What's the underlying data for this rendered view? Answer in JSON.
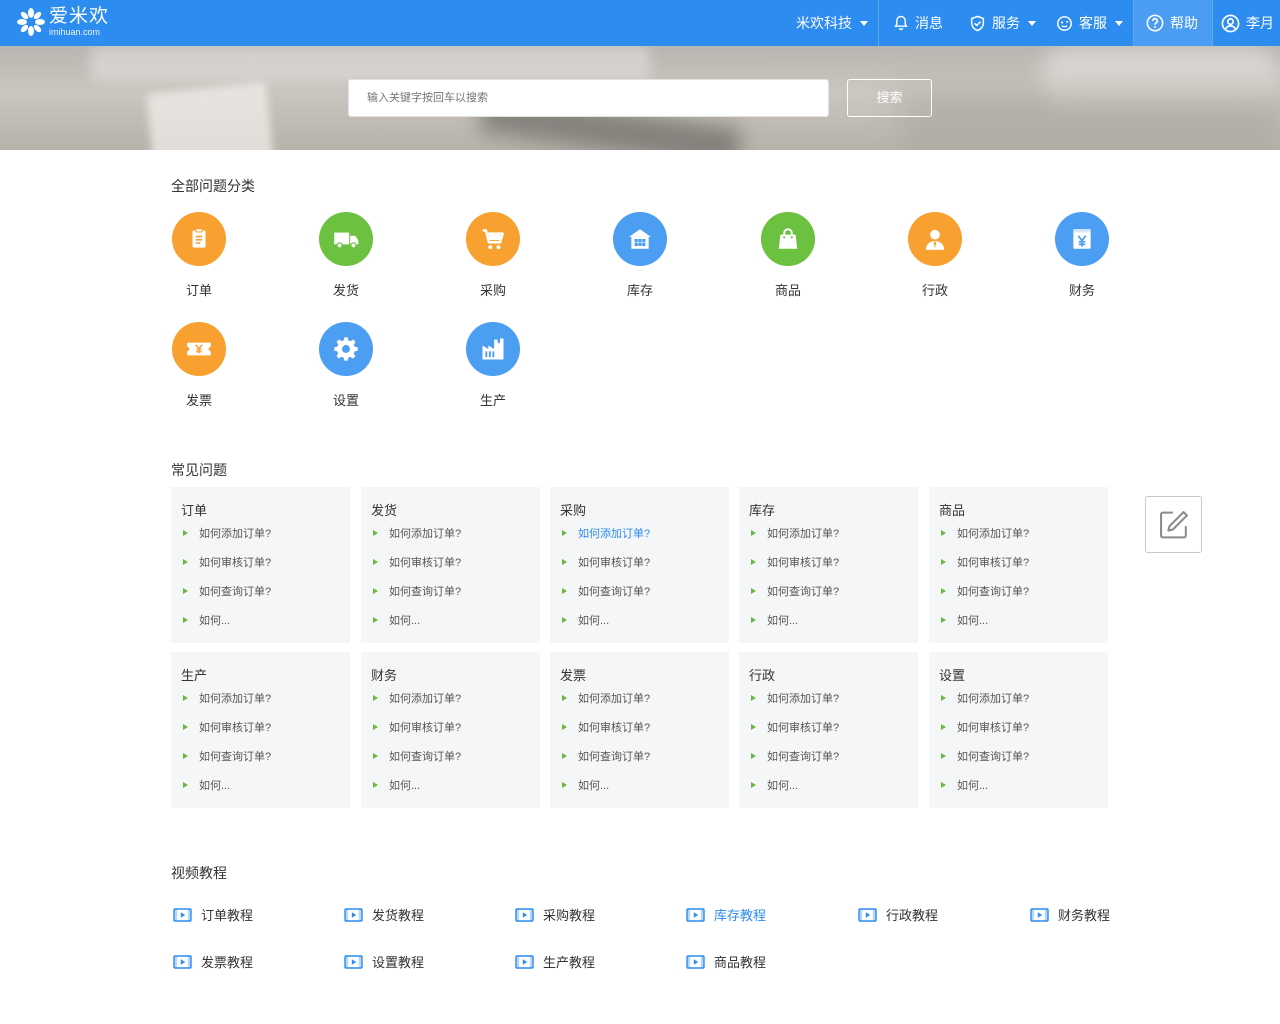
{
  "header": {
    "logo_cn": "爱米欢",
    "logo_en": "imihuan.com",
    "company": "米欢科技",
    "messages": "消息",
    "service": "服务",
    "support": "客服",
    "help": "帮助",
    "user": "李月",
    "colors": {
      "bar": "#2d8cf0"
    }
  },
  "search": {
    "placeholder": "输入关键字按回车以搜索",
    "button": "搜索"
  },
  "categories": {
    "title": "全部问题分类",
    "items": [
      {
        "label": "订单",
        "icon": "clipboard-icon",
        "color": "#f8a130"
      },
      {
        "label": "发货",
        "icon": "truck-icon",
        "color": "#6cc141"
      },
      {
        "label": "采购",
        "icon": "cart-icon",
        "color": "#f8a130"
      },
      {
        "label": "库存",
        "icon": "warehouse-icon",
        "color": "#4c9ef2"
      },
      {
        "label": "商品",
        "icon": "shopping-bag-icon",
        "color": "#6cc141"
      },
      {
        "label": "行政",
        "icon": "person-icon",
        "color": "#f8a130"
      },
      {
        "label": "财务",
        "icon": "yuan-icon",
        "color": "#4c9ef2"
      },
      {
        "label": "发票",
        "icon": "ticket-icon",
        "color": "#f8a130"
      },
      {
        "label": "设置",
        "icon": "gear-icon",
        "color": "#4c9ef2"
      },
      {
        "label": "生产",
        "icon": "factory-icon",
        "color": "#4c9ef2"
      }
    ]
  },
  "faq": {
    "title": "常见问题",
    "cards": [
      {
        "title": "订单",
        "q": [
          "如何添加订单?",
          "如何审核订单?",
          "如何查询订单?",
          "如何..."
        ]
      },
      {
        "title": "发货",
        "q": [
          "如何添加订单?",
          "如何审核订单?",
          "如何查询订单?",
          "如何..."
        ]
      },
      {
        "title": "采购",
        "q": [
          "如何添加订单?",
          "如何审核订单?",
          "如何查询订单?",
          "如何..."
        ]
      },
      {
        "title": "库存",
        "q": [
          "如何添加订单?",
          "如何审核订单?",
          "如何查询订单?",
          "如何..."
        ]
      },
      {
        "title": "商品",
        "q": [
          "如何添加订单?",
          "如何审核订单?",
          "如何查询订单?",
          "如何..."
        ]
      },
      {
        "title": "生产",
        "q": [
          "如何添加订单?",
          "如何审核订单?",
          "如何查询订单?",
          "如何..."
        ]
      },
      {
        "title": "财务",
        "q": [
          "如何添加订单?",
          "如何审核订单?",
          "如何查询订单?",
          "如何..."
        ]
      },
      {
        "title": "发票",
        "q": [
          "如何添加订单?",
          "如何审核订单?",
          "如何查询订单?",
          "如何..."
        ]
      },
      {
        "title": "行政",
        "q": [
          "如何添加订单?",
          "如何审核订单?",
          "如何查询订单?",
          "如何..."
        ]
      },
      {
        "title": "设置",
        "q": [
          "如何添加订单?",
          "如何审核订单?",
          "如何查询订单?",
          "如何..."
        ]
      }
    ],
    "highlight": {
      "card": 2,
      "question": 0,
      "color": "#2d8cf0"
    }
  },
  "videos": {
    "title": "视频教程",
    "items": [
      "订单教程",
      "发货教程",
      "采购教程",
      "库存教程",
      "行政教程",
      "财务教程",
      "发票教程",
      "设置教程",
      "生产教程",
      "商品教程"
    ],
    "highlight": 3,
    "icon": "video-icon"
  }
}
